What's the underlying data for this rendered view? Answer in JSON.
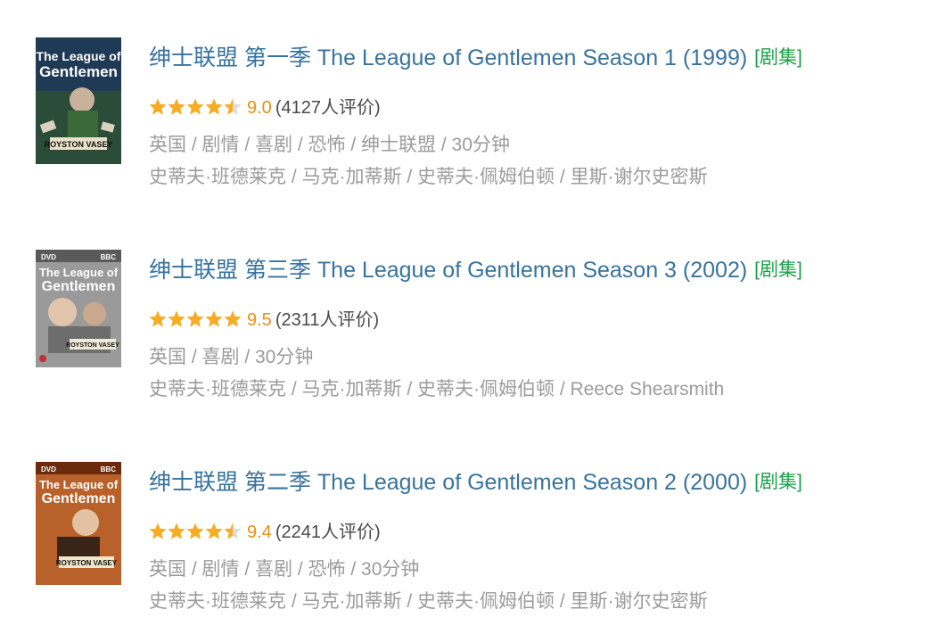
{
  "colors": {
    "title_link": "#37739e",
    "tag": "#1b9f4a",
    "score": "#e59113",
    "star_fill": "#f6ad24",
    "star_empty": "#dcdcdc",
    "meta_text": "#9b9b9b",
    "count_text": "#494949"
  },
  "items": [
    {
      "poster_icon": "poster-league-of-gentlemen-s1",
      "title": "绅士联盟 第一季 The League of Gentlemen Season 1 (1999)",
      "tag": "[剧集]",
      "stars": 4.5,
      "score": "9.0",
      "count": "(4127人评价)",
      "info": "英国 / 剧情 / 喜剧 / 恐怖 / 绅士联盟 / 30分钟",
      "cast": "史蒂夫·班德莱克 / 马克·加蒂斯 / 史蒂夫·佩姆伯顿 / 里斯·谢尔史密斯",
      "poster": {
        "title_top": "The League of",
        "title_bottom": "Gentlemen",
        "banner": "ROYSTON VASEY"
      }
    },
    {
      "poster_icon": "poster-league-of-gentlemen-s3",
      "title": "绅士联盟 第三季 The League of Gentlemen Season 3 (2002)",
      "tag": "[剧集]",
      "stars": 5,
      "score": "9.5",
      "count": "(2311人评价)",
      "info": "英国 / 喜剧 / 30分钟",
      "cast": "史蒂夫·班德莱克 / 马克·加蒂斯 / 史蒂夫·佩姆伯顿 / Reece Shearsmith",
      "poster": {
        "title_top": "The League of",
        "title_bottom": "Gentlemen",
        "banner": "ROYSTON VASEY",
        "dvd": "DVD",
        "bbc": "BBC"
      }
    },
    {
      "poster_icon": "poster-league-of-gentlemen-s2",
      "title": "绅士联盟 第二季 The League of Gentlemen Season 2 (2000)",
      "tag": "[剧集]",
      "stars": 4.5,
      "score": "9.4",
      "count": "(2241人评价)",
      "info": "英国 / 剧情 / 喜剧 / 恐怖 / 30分钟",
      "cast": "史蒂夫·班德莱克 / 马克·加蒂斯 / 史蒂夫·佩姆伯顿 / 里斯·谢尔史密斯",
      "poster": {
        "title_top": "The League of",
        "title_bottom": "Gentlemen",
        "banner": "ROYSTON VASEY",
        "dvd": "DVD",
        "bbc": "BBC"
      }
    }
  ]
}
